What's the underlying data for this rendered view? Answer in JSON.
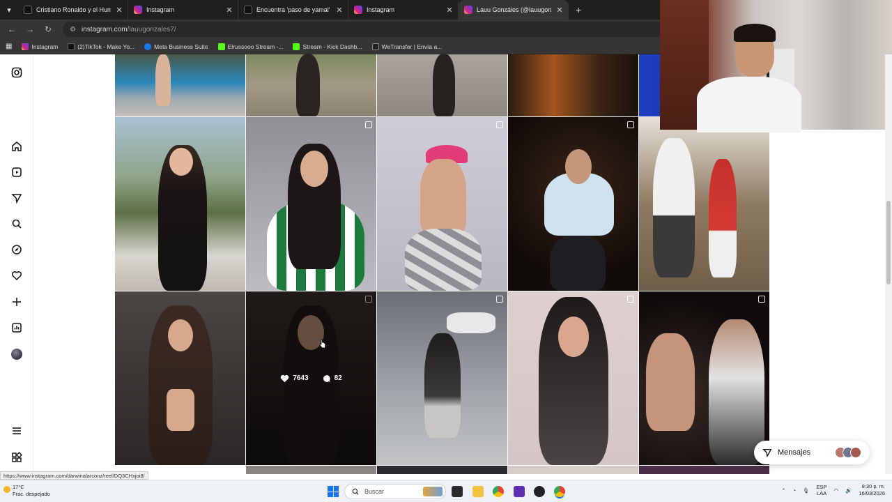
{
  "browser": {
    "tabs": [
      {
        "title": "Cristiano Ronaldo y el Humor e",
        "favicon": "tiktok-icon",
        "active": false
      },
      {
        "title": "Instagram",
        "favicon": "instagram-icon",
        "active": false
      },
      {
        "title": "Encuentra 'paso de yamal' en T",
        "favicon": "tiktok-icon",
        "active": false
      },
      {
        "title": "Instagram",
        "favicon": "instagram-icon",
        "active": false
      },
      {
        "title": "Lauu Gonzáles (@lauugonzale",
        "favicon": "instagram-icon",
        "active": true
      }
    ],
    "url_host": "instagram.com",
    "url_path": "/lauugonzales7/",
    "bookmarks": [
      {
        "label": "Instagram"
      },
      {
        "label": "(2)TikTok - Make Yo..."
      },
      {
        "label": "Meta Business Suite"
      },
      {
        "label": "Elrussooo Stream -..."
      },
      {
        "label": "Stream - Kick Dashb..."
      },
      {
        "label": "WeTransfer | Envía a..."
      }
    ]
  },
  "instagram": {
    "hover_post": {
      "likes": "7643",
      "comments": "82"
    }
  },
  "status_bar_url": "https://www.instagram.com/darwinalarconz/reel/DQ3CHxjoi8/",
  "messages_button": {
    "label": "Mensajes"
  },
  "taskbar": {
    "weather_temp": "17°C",
    "weather_desc": "Frac. despejado",
    "search_placeholder": "Buscar",
    "lang_top": "ESP",
    "lang_bottom": "LAA",
    "time": "9:30 p. m.",
    "date": "16/03/2026"
  },
  "colors": {
    "browser_dark": "#1f1f1f",
    "instagram_gradient": [
      "#feda75",
      "#d62976",
      "#962fbf",
      "#4f5bd5"
    ]
  }
}
